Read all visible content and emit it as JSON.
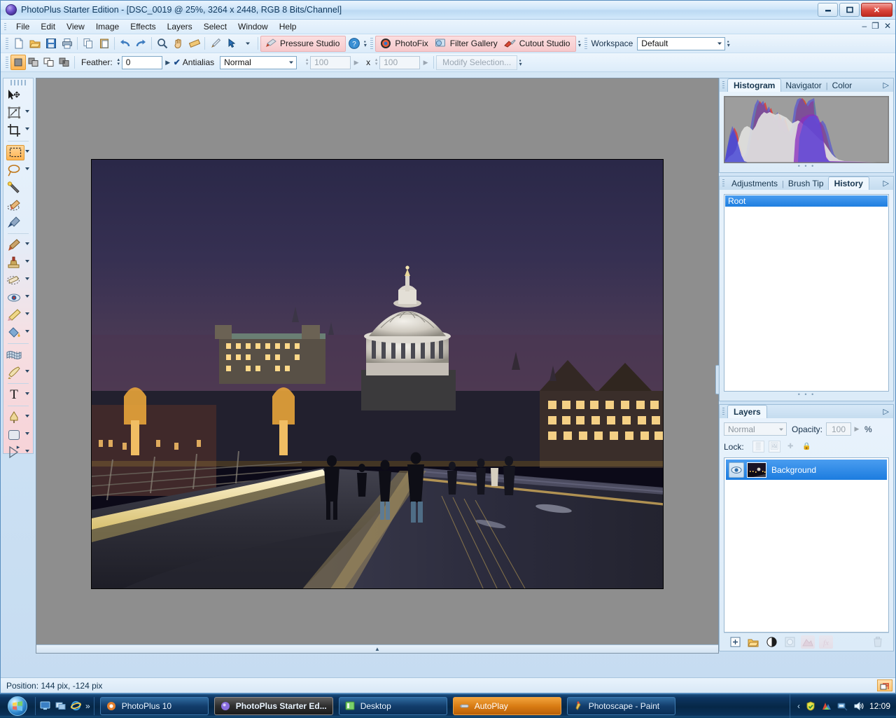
{
  "window": {
    "title": "PhotoPlus Starter Edition - [DSC_0019 @ 25%, 3264 x 2448, RGB 8 Bits/Channel]",
    "logo_icon": "photoplus-orb-icon",
    "minimize_label": "–",
    "maximize_label": "□",
    "close_label": "✕"
  },
  "mdi": {
    "minimize": "–",
    "restore": "❐",
    "close": "✕"
  },
  "menu": {
    "items": [
      {
        "label": "File"
      },
      {
        "label": "Edit"
      },
      {
        "label": "View"
      },
      {
        "label": "Image"
      },
      {
        "label": "Effects"
      },
      {
        "label": "Layers"
      },
      {
        "label": "Select"
      },
      {
        "label": "Window"
      },
      {
        "label": "Help"
      }
    ]
  },
  "toolbar": {
    "buttons": [
      {
        "name": "new-document-button",
        "icon": "🗋"
      },
      {
        "name": "open-file-button",
        "icon": "📂"
      },
      {
        "name": "save-button",
        "icon": "💾"
      },
      {
        "name": "print-button",
        "icon": "🖨"
      },
      {
        "name": "copy-button",
        "icon": "⧉"
      },
      {
        "name": "paste-button",
        "icon": "📋"
      },
      {
        "name": "undo-button",
        "icon": "↶"
      },
      {
        "name": "redo-button",
        "icon": "↷"
      },
      {
        "name": "zoom-tool-button",
        "icon": "🔍"
      },
      {
        "name": "pan-tool-button",
        "icon": "✋"
      },
      {
        "name": "measure-tool-button",
        "icon": "📏"
      },
      {
        "name": "brush-tool-button",
        "icon": "🖌"
      },
      {
        "name": "node-select-button",
        "icon": "↖"
      }
    ],
    "pressure_studio_label": "Pressure Studio",
    "pressure_studio_icon": "brush-icon",
    "help_label": "?",
    "photofix_label": "PhotoFix",
    "photofix_icon": "photofix-target-icon",
    "filter_gallery_label": "Filter Gallery",
    "filter_gallery_icon": "filter-gallery-icon",
    "cutout_studio_label": "Cutout Studio",
    "cutout_studio_icon": "cutout-knife-icon",
    "workspace_label": "Workspace",
    "workspace_value": "Default"
  },
  "options_bar": {
    "mode_buttons": [
      {
        "name": "new-selection-button",
        "icon": "■",
        "active": true
      },
      {
        "name": "add-selection-button",
        "icon": "⧉"
      },
      {
        "name": "subtract-selection-button",
        "icon": "❐"
      },
      {
        "name": "intersect-selection-button",
        "icon": "▣"
      }
    ],
    "feather_label": "Feather:",
    "feather_value": "0",
    "antialias_label": "Antialias",
    "antialias_checked": true,
    "style_value": "Normal",
    "width_value": "100",
    "times_label": "x",
    "height_value": "100",
    "modify_selection_label": "Modify Selection..."
  },
  "toolbox": {
    "tools": [
      {
        "name": "move-tool",
        "icon": "➤",
        "dropdown": false,
        "selected": false
      },
      {
        "name": "deform-tool",
        "icon": "◱",
        "dropdown": true,
        "selected": false
      },
      {
        "name": "crop-tool",
        "icon": "⛶",
        "dropdown": true,
        "selected": false
      },
      {
        "name": "rectangle-select-tool",
        "icon": "▣",
        "dropdown": true,
        "selected": true
      },
      {
        "name": "lasso-select-tool",
        "icon": "◯",
        "dropdown": true,
        "selected": false
      },
      {
        "name": "magic-wand-tool",
        "icon": "✨",
        "dropdown": false,
        "selected": false
      },
      {
        "name": "background-eraser-tool",
        "icon": "🪣",
        "dropdown": false,
        "selected": false
      },
      {
        "name": "color-picker-tool",
        "icon": "💉",
        "dropdown": false,
        "selected": false
      },
      {
        "name": "paintbrush-tool",
        "icon": "🖌",
        "dropdown": true,
        "selected": false
      },
      {
        "name": "clone-stamp-tool",
        "icon": "🖋",
        "dropdown": true,
        "selected": false
      },
      {
        "name": "eraser-tool",
        "icon": "▱",
        "dropdown": true,
        "selected": false
      },
      {
        "name": "red-eye-tool",
        "icon": "👁",
        "dropdown": true,
        "selected": false
      },
      {
        "name": "smudge-tool",
        "icon": "✎",
        "dropdown": true,
        "selected": false
      },
      {
        "name": "flood-fill-tool",
        "icon": "🪣",
        "dropdown": true,
        "selected": false
      },
      {
        "name": "mesh-warp-tool",
        "icon": "⌗",
        "dropdown": false,
        "selected": false
      },
      {
        "name": "quickshape-tool",
        "icon": "✒",
        "dropdown": true,
        "selected": false
      },
      {
        "name": "text-tool",
        "icon": "T",
        "dropdown": true,
        "selected": false
      },
      {
        "name": "pen-tool",
        "icon": "✑",
        "dropdown": true,
        "selected": false
      },
      {
        "name": "shape-tool",
        "icon": "▢",
        "dropdown": true,
        "selected": false
      },
      {
        "name": "node-edit-tool",
        "icon": "▷",
        "dropdown": true,
        "selected": false
      }
    ],
    "expand_label": "▸"
  },
  "panels": {
    "histogram": {
      "tabs": [
        {
          "label": "Histogram",
          "active": true
        },
        {
          "label": "Navigator",
          "active": false
        },
        {
          "label": "Color",
          "active": false
        }
      ],
      "arrow": "▷"
    },
    "history": {
      "tabs": [
        {
          "label": "Adjustments",
          "active": false
        },
        {
          "label": "Brush Tip",
          "active": false
        },
        {
          "label": "History",
          "active": true
        }
      ],
      "arrow": "▷",
      "entries": [
        {
          "label": "Root",
          "selected": true
        }
      ]
    },
    "layers": {
      "tabs": [
        {
          "label": "Layers",
          "active": true
        }
      ],
      "arrow": "▷",
      "blend_mode": "Normal",
      "opacity_label": "Opacity:",
      "opacity_value": "100",
      "percent_label": "%",
      "lock_label": "Lock:",
      "lock_buttons": [
        {
          "name": "lock-transparency-button",
          "icon": "▒"
        },
        {
          "name": "lock-image-button",
          "icon": "🖼"
        },
        {
          "name": "lock-position-button",
          "icon": "✚"
        },
        {
          "name": "lock-all-button",
          "icon": "🔒"
        }
      ],
      "items": [
        {
          "name": "Background",
          "visible": true,
          "selected": true,
          "eye_icon": "eye-icon"
        }
      ],
      "footer_buttons": [
        {
          "name": "add-layer-button",
          "icon": "⊞",
          "dim": false,
          "pink": false
        },
        {
          "name": "new-group-button",
          "icon": "📁",
          "dim": false,
          "pink": false
        },
        {
          "name": "adjustment-layer-button",
          "icon": "◑",
          "dim": false,
          "pink": false
        },
        {
          "name": "layer-mask-button",
          "icon": "▣",
          "dim": true,
          "pink": false
        },
        {
          "name": "mask-button",
          "icon": "▲",
          "dim": true,
          "pink": true
        },
        {
          "name": "layer-effects-button",
          "icon": "ƒx",
          "dim": true,
          "pink": true
        },
        {
          "name": "delete-layer-button",
          "icon": "🗑",
          "dim": true,
          "pink": false
        }
      ]
    }
  },
  "document": {
    "zoom": "25%",
    "dimensions": "3264 x 2448",
    "color_mode": "RGB 8 Bits/Channel",
    "filename": "DSC_0019"
  },
  "status": {
    "position_text": "Position: 144 pix, -124 pix",
    "corner_icon": "resize-grip-icon"
  },
  "taskbar": {
    "start_icon": "windows-start-orb",
    "quick_launch": [
      {
        "name": "show-desktop-icon",
        "icon": "🗔"
      },
      {
        "name": "switch-windows-icon",
        "icon": "⧉"
      },
      {
        "name": "internet-explorer-icon",
        "icon": "℮"
      }
    ],
    "quick_launch_overflow": "»",
    "items": [
      {
        "label": "PhotoPlus 10",
        "icon": "photoplus-icon",
        "state": "normal"
      },
      {
        "label": "PhotoPlus Starter Ed...",
        "icon": "photoplus-starter-icon",
        "state": "active"
      },
      {
        "label": "Desktop",
        "icon": "folder-icon",
        "state": "normal"
      },
      {
        "label": "AutoPlay",
        "icon": "autoplay-icon",
        "state": "orange"
      },
      {
        "label": "Photoscape - Paint",
        "icon": "photoscape-icon",
        "state": "normal"
      }
    ],
    "tray": {
      "expand_icon": "‹",
      "icons": [
        {
          "name": "antivirus-tray-icon",
          "icon": "🛡"
        },
        {
          "name": "colorful-tray-icon",
          "icon": "◩"
        },
        {
          "name": "network-tray-icon",
          "icon": "🖧"
        },
        {
          "name": "volume-tray-icon",
          "icon": "🔊"
        }
      ],
      "clock": "12:09"
    }
  },
  "colors": {
    "accent": "#1c7cdf",
    "pink_group": "#f6c9cc",
    "selection_orange": "#ffb450",
    "canvas_gray": "#8e8e8e"
  }
}
